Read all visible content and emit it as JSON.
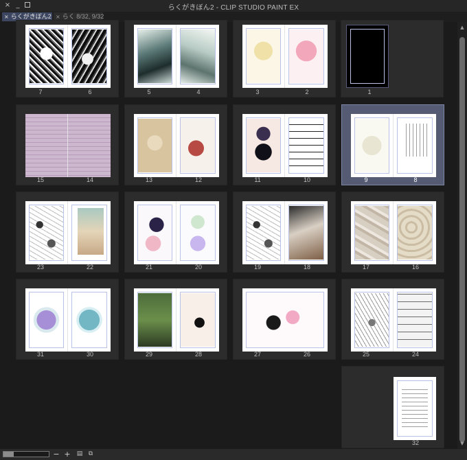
{
  "window": {
    "title": "らくがきぼん2 - CLIP STUDIO PAINT EX",
    "min_label": "_",
    "close_label": "×"
  },
  "tabs": [
    {
      "label": "らくがきぼん2",
      "close": "×"
    },
    {
      "label": "らく 8/32, 9/32",
      "close": "×"
    }
  ],
  "spreads": [
    {
      "left": "7",
      "right": "6"
    },
    {
      "left": "5",
      "right": "4"
    },
    {
      "left": "3",
      "right": "2"
    },
    {
      "single": "1"
    },
    {
      "left": "15",
      "right": "14"
    },
    {
      "left": "13",
      "right": "12"
    },
    {
      "left": "11",
      "right": "10"
    },
    {
      "left": "9",
      "right": "8"
    },
    {
      "left": "23",
      "right": "22"
    },
    {
      "left": "21",
      "right": "20"
    },
    {
      "left": "19",
      "right": "18"
    },
    {
      "left": "17",
      "right": "16"
    },
    {
      "left": "31",
      "right": "30"
    },
    {
      "left": "29",
      "right": "28"
    },
    {
      "left": "27",
      "right": "26"
    },
    {
      "left": "25",
      "right": "24"
    },
    {
      "single": "32"
    }
  ],
  "selected_spread": "9-8",
  "statusbar": {
    "zoom_out": "−",
    "zoom_in": "+",
    "pages_icon": "pages-icon",
    "view_icon": "view-icon",
    "slider_level": 0.22
  },
  "scrollbar": {
    "up": "▲",
    "down": "▼"
  }
}
